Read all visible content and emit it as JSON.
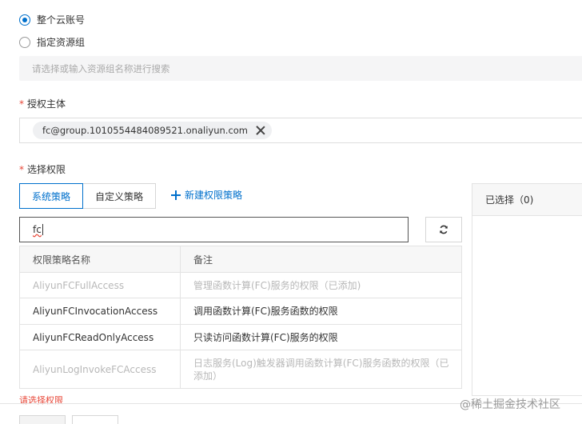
{
  "scope": {
    "option_account": "整个云账号",
    "option_group": "指定资源组",
    "group_placeholder": "请选择或输入资源组名称进行搜索"
  },
  "principal": {
    "label": "授权主体",
    "required_mark": "*",
    "tag": "fc@group.1010554484089521.onaliyun.com"
  },
  "permissions": {
    "label": "选择权限",
    "required_mark": "*",
    "tab_system": "系统策略",
    "tab_custom": "自定义策略",
    "new_policy": "新建权限策略",
    "search_value": "fc",
    "columns": [
      "权限策略名称",
      "备注"
    ],
    "rows": [
      {
        "name": "AliyunFCFullAccess",
        "note": "管理函数计算(FC)服务的权限（已添加)",
        "disabled": true
      },
      {
        "name": "AliyunFCInvocationAccess",
        "note": "调用函数计算(FC)服务函数的权限",
        "disabled": false
      },
      {
        "name": "AliyunFCReadOnlyAccess",
        "note": "只读访问函数计算(FC)服务的权限",
        "disabled": false
      },
      {
        "name": "AliyunLogInvokeFCAccess",
        "note": "日志服务(Log)触发器调用函数计算(FC)服务函数的权限（已添加）",
        "disabled": true
      }
    ],
    "error": "请选择权限"
  },
  "selected": {
    "header": "已选择（0)"
  },
  "watermark": "@稀土掘金技术社区",
  "colors": {
    "accent": "#0070cc",
    "error": "#e84738"
  }
}
